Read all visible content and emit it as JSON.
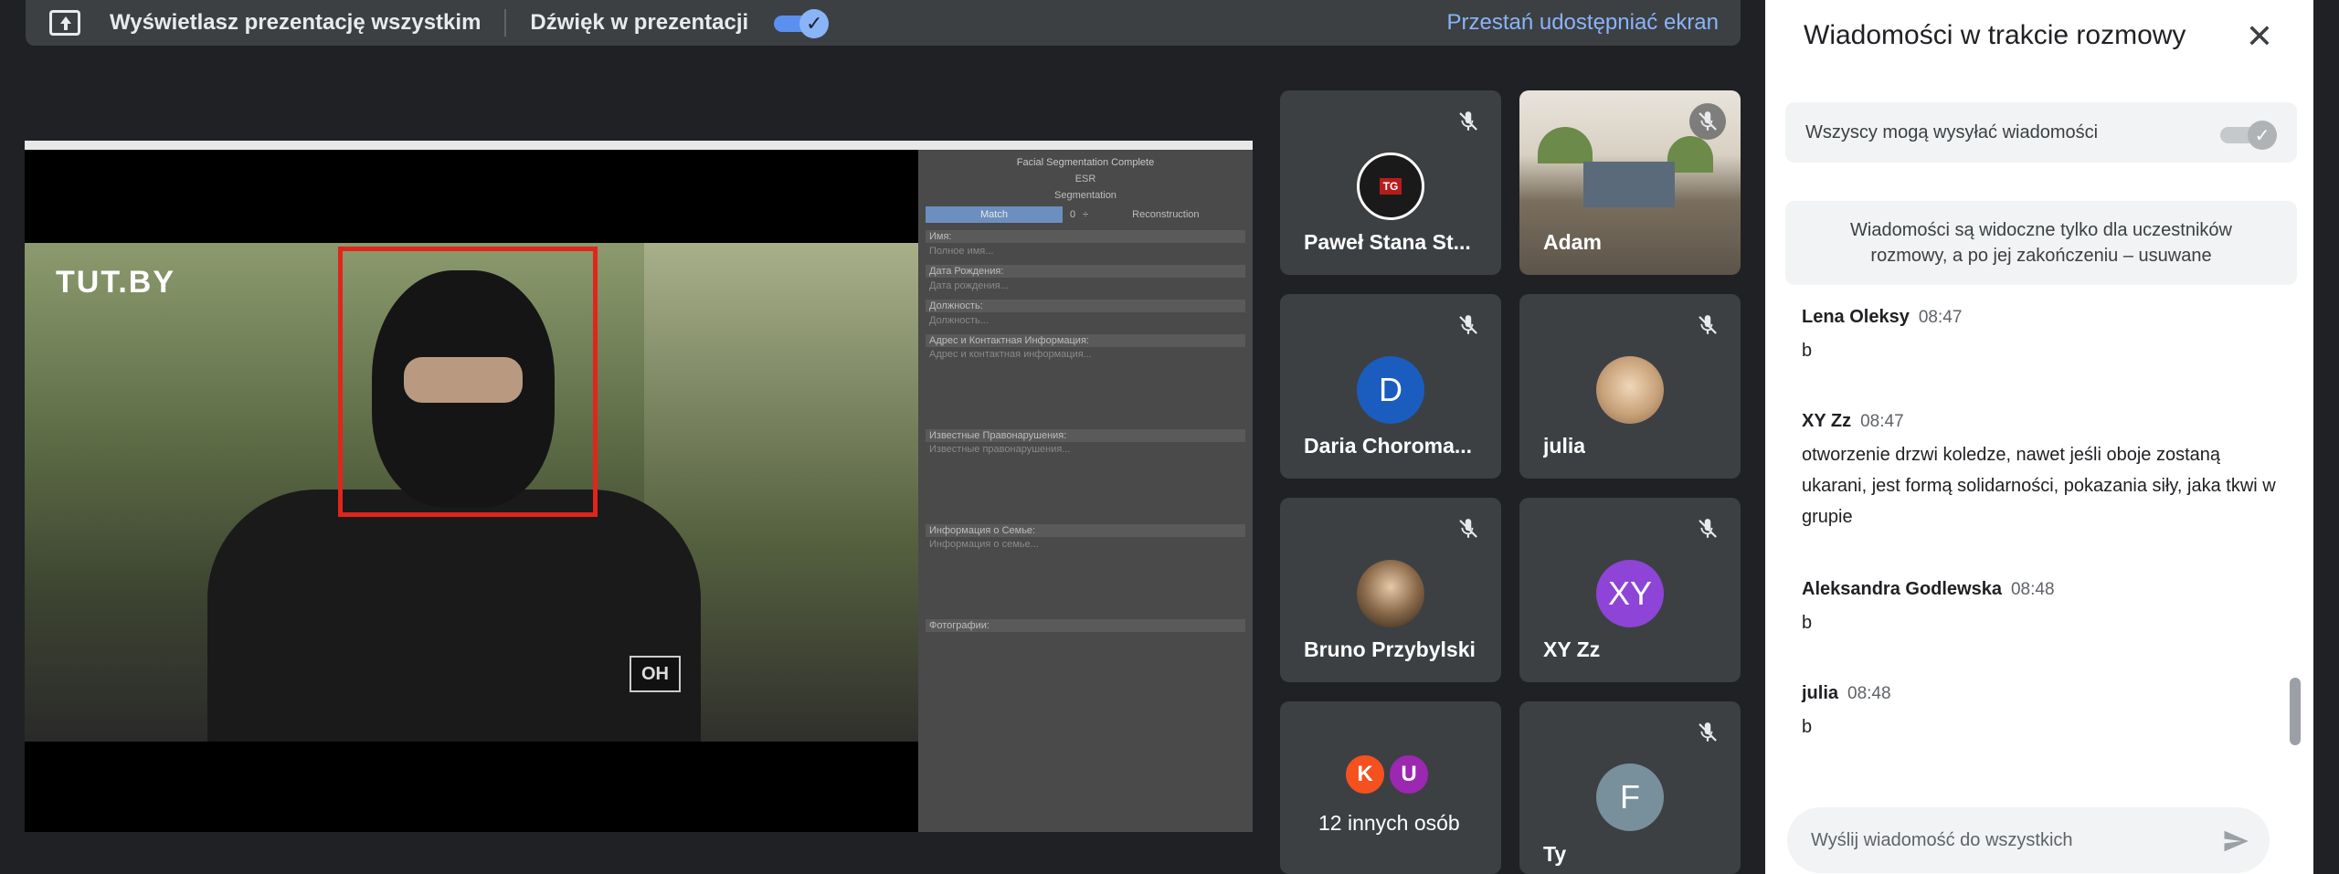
{
  "topbar": {
    "presenting_label": "Wyświetlasz prezentację wszystkim",
    "audio_label": "Dźwięk w prezentacji",
    "stop_label": "Przestań udostępniać ekran"
  },
  "shared_screen": {
    "logo_text": "TUT.BY",
    "patch_text": "OH",
    "panel": {
      "title": "Facial Segmentation Complete",
      "line1": "ESR",
      "line2": "Segmentation",
      "match_label": "Match",
      "match_value": "0",
      "reconstruction_label": "Reconstruction",
      "fields": [
        {
          "label": "Имя:",
          "placeholder": "Полное имя..."
        },
        {
          "label": "Дата Рождения:",
          "placeholder": "Дата рождения..."
        },
        {
          "label": "Должность:",
          "placeholder": "Должность..."
        },
        {
          "label": "Адрес и Контактная Информация:",
          "placeholder": "Адрес и контактная информация..."
        },
        {
          "label": "Известные Правонарушения:",
          "placeholder": "Известные правонарушения..."
        },
        {
          "label": "Информация о Семье:",
          "placeholder": "Информация о семье..."
        },
        {
          "label": "Фотографии:",
          "placeholder": ""
        }
      ]
    }
  },
  "participants": [
    {
      "name": "Paweł Stana St...",
      "avatar_letter": "",
      "avatar_color": "#b71c1c"
    },
    {
      "name": "Adam",
      "avatar_letter": "",
      "avatar_color": ""
    },
    {
      "name": "Daria Choroma...",
      "avatar_letter": "D",
      "avatar_color": "#1a5dbf"
    },
    {
      "name": "julia",
      "avatar_letter": "",
      "avatar_color": "#c8a27a"
    },
    {
      "name": "Bruno Przybylski",
      "avatar_letter": "",
      "avatar_color": "#5b4a3a"
    },
    {
      "name": "XY Zz",
      "avatar_letter": "XY",
      "avatar_color": "#8e44d6"
    },
    {
      "name": "12 innych osób",
      "avatar_letters": [
        "K",
        "U"
      ],
      "avatar_colors": [
        "#f4511e",
        "#9c27b0"
      ]
    },
    {
      "name": "Ty",
      "avatar_letter": "F",
      "avatar_color": "#78909c"
    }
  ],
  "chat": {
    "title": "Wiadomości w trakcie rozmowy",
    "permission_label": "Wszyscy mogą wysyłać wiadomości",
    "notice": "Wiadomości są widoczne tylko dla uczestników rozmowy, a po jej zakończeniu – usuwane",
    "messages": [
      {
        "author": "Lena Oleksy",
        "time": "08:47",
        "text": "b"
      },
      {
        "author": "XY Zz",
        "time": "08:47",
        "text": "otworzenie drzwi koledze, nawet jeśli oboje zostaną ukarani, jest formą solidarności, pokazania siły, jaka tkwi w grupie"
      },
      {
        "author": "Aleksandra Godlewska",
        "time": "08:48",
        "text": "b"
      },
      {
        "author": "julia",
        "time": "08:48",
        "text": "b"
      }
    ],
    "input_placeholder": "Wyślij wiadomość do wszystkich"
  },
  "icons": {
    "present": "present-to-all-icon",
    "check": "check-icon",
    "mic_off": "mic-off-icon",
    "close": "close-icon",
    "send": "send-icon"
  },
  "colors": {
    "accent": "#8ab4f8",
    "tile_bg": "#3c4043",
    "page_bg": "#202124",
    "face_box": "#e0251b"
  }
}
